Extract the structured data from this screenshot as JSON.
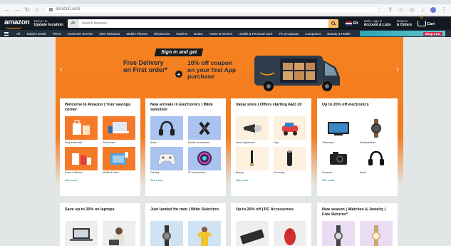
{
  "browser": {
    "url": "amazon.com"
  },
  "topnav": {
    "logo": "amazon",
    "deliver_line1": "Deliver to",
    "deliver_line2": "Update location",
    "search_category": "All",
    "search_placeholder": "Search Amazon",
    "language": "EN",
    "account_line1": "Hello, sign in",
    "account_line2": "Account & Lists",
    "returns_line1": "Returns",
    "returns_line2": "& Orders",
    "cart_count": "0",
    "cart_label": "Cart"
  },
  "subnav": {
    "items": [
      "All",
      "Today's Deals",
      "Prime",
      "Customer Service",
      "New Releases",
      "Mobile Phones",
      "Electronics",
      "Fashion",
      "Books",
      "Home & Kitchen",
      "Health & Personal Care",
      "PC & Laptops",
      "Computers",
      "Beauty & Health"
    ],
    "promo": "Shop now"
  },
  "hero": {
    "signin": "Sign in and get",
    "left_title_1": "Free Delivery",
    "left_title_2": "on First order*",
    "right_title_1": "10% off coupon",
    "right_title_2": "on your first App",
    "right_title_3": "purchase",
    "colors": {
      "orange": "#f58220",
      "navy": "#1b2a3a"
    }
  },
  "cards_row1": [
    {
      "title": "Welcome to Amazon | Your savings corner",
      "tiles": [
        {
          "caption": "Daily essentials",
          "bg": "#f47a2a",
          "icon": "shopping-bags-icon"
        },
        {
          "caption": "Electronics",
          "bg": "#f47a2a",
          "icon": "laptop-icon"
        },
        {
          "caption": "Home & kitchen",
          "bg": "#f47a2a",
          "icon": "appliance-icon"
        },
        {
          "caption": "Mobile & more",
          "bg": "#f47a2a",
          "icon": "gift-box-icon"
        }
      ],
      "see_more": "See more"
    },
    {
      "title": "New arrivals in Electronics | Wide selection",
      "tiles": [
        {
          "caption": "Audio",
          "bg": "#a9c2f0",
          "icon": "headphones-icon"
        },
        {
          "caption": "Mobile accessories",
          "bg": "#a9c2f0",
          "icon": "gimbal-icon"
        },
        {
          "caption": "Gaming",
          "bg": "#a9c2f0",
          "icon": "gamepad-icon"
        },
        {
          "caption": "PC accessories",
          "bg": "#a9c2f0",
          "icon": "fan-icon"
        }
      ],
      "see_more": "See more"
    },
    {
      "title": "Value store | Offers starting AED 20",
      "tiles": [
        {
          "caption": "Home appliances",
          "bg": "#fdf0de",
          "icon": "spotlight-icon"
        },
        {
          "caption": "Toys",
          "bg": "#fdf0de",
          "icon": "toy-car-icon"
        },
        {
          "caption": "Beauty",
          "bg": "#fdf0de",
          "icon": "brush-icon"
        },
        {
          "caption": "Grooming",
          "bg": "#fdf0de",
          "icon": "trimmer-icon"
        }
      ],
      "see_more": "See more"
    },
    {
      "title": "Up to 20% off electronics",
      "tiles": [
        {
          "caption": "Televisions",
          "bg": "#ffffff",
          "icon": "television-icon"
        },
        {
          "caption": "Smartwatches",
          "bg": "#ffffff",
          "icon": "smartwatch-icon"
        },
        {
          "caption": "Cameras",
          "bg": "#ffffff",
          "icon": "camera-icon"
        },
        {
          "caption": "Audio",
          "bg": "#ffffff",
          "icon": "headphones-icon"
        }
      ],
      "see_more": "See more"
    }
  ],
  "cards_row2": [
    {
      "title": "Save up to 20% on laptops",
      "tiles": [
        {
          "icon": "laptop-icon",
          "bg": "#eeeeee"
        },
        {
          "icon": "person-laptop-icon",
          "bg": "#eeeeee"
        }
      ]
    },
    {
      "title": "Just landed for men | Wide Selection",
      "tiles": [
        {
          "icon": "watch-icon",
          "bg": "#cfe3f3"
        },
        {
          "icon": "tshirt-icon",
          "bg": "#cfe3f3"
        }
      ]
    },
    {
      "title": "Up to 20% off | PC Accessories",
      "tiles": [
        {
          "icon": "keyboard-icon",
          "bg": "#eeeeee"
        },
        {
          "icon": "mouse-icon",
          "bg": "#eeeeee"
        }
      ]
    },
    {
      "title": "New season | Watches & Jewelry | Free Returns*",
      "tiles": [
        {
          "icon": "watch-icon",
          "bg": "#e9dcf3"
        },
        {
          "icon": "watch-icon",
          "bg": "#e9dcf3"
        }
      ]
    }
  ]
}
